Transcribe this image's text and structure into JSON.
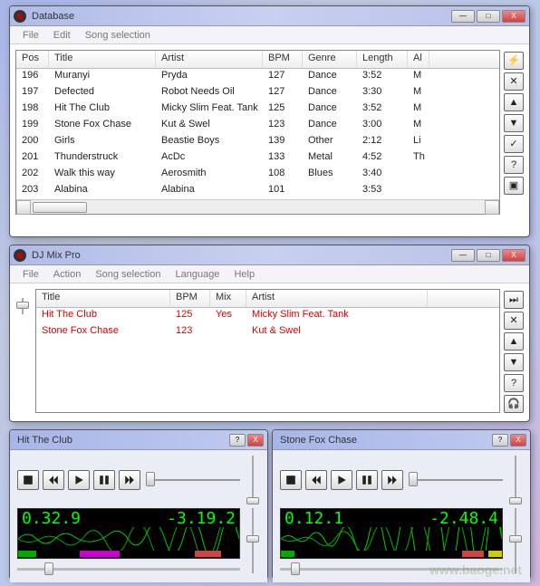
{
  "db": {
    "title": "Database",
    "menu": [
      "File",
      "Edit",
      "Song selection"
    ],
    "headers": {
      "pos": "Pos",
      "title": "Title",
      "artist": "Artist",
      "bpm": "BPM",
      "genre": "Genre",
      "length": "Length",
      "al": "Al"
    },
    "rows": [
      {
        "pos": "196",
        "title": "Muranyi",
        "artist": "Pryda",
        "bpm": "127",
        "genre": "Dance",
        "length": "3:52",
        "al": "M"
      },
      {
        "pos": "197",
        "title": "Defected",
        "artist": "Robot Needs Oil",
        "bpm": "127",
        "genre": "Dance",
        "length": "3:30",
        "al": "M"
      },
      {
        "pos": "198",
        "title": "Hit The Club",
        "artist": "Micky Slim Feat. Tank",
        "bpm": "125",
        "genre": "Dance",
        "length": "3:52",
        "al": "M"
      },
      {
        "pos": "199",
        "title": "Stone Fox Chase",
        "artist": "Kut & Swel",
        "bpm": "123",
        "genre": "Dance",
        "length": "3:00",
        "al": "M"
      },
      {
        "pos": "200",
        "title": "Girls",
        "artist": "Beastie Boys",
        "bpm": "139",
        "genre": "Other",
        "length": "2:12",
        "al": "Li"
      },
      {
        "pos": "201",
        "title": "Thunderstruck",
        "artist": "AcDc",
        "bpm": "133",
        "genre": "Metal",
        "length": "4:52",
        "al": "Th"
      },
      {
        "pos": "202",
        "title": "Walk this way",
        "artist": "Aerosmith",
        "bpm": "108",
        "genre": "Blues",
        "length": "3:40",
        "al": ""
      },
      {
        "pos": "203",
        "title": "Alabina",
        "artist": "Alabina",
        "bpm": "101",
        "genre": "",
        "length": "3:53",
        "al": ""
      }
    ],
    "sidebtns": [
      "⚡",
      "✕",
      "▲",
      "▼",
      "✓",
      "?",
      "▣"
    ]
  },
  "mix": {
    "title": "DJ Mix Pro",
    "menu": [
      "File",
      "Action",
      "Song selection",
      "Language",
      "Help"
    ],
    "headers": {
      "title": "Title",
      "bpm": "BPM",
      "mix": "Mix",
      "artist": "Artist"
    },
    "rows": [
      {
        "title": "Hit The Club",
        "bpm": "125",
        "mix": "Yes",
        "artist": "Micky Slim Feat. Tank"
      },
      {
        "title": "Stone Fox Chase",
        "bpm": "123",
        "mix": "",
        "artist": "Kut & Swel"
      }
    ],
    "sidebtns": [
      "⏭",
      "✕",
      "▲",
      "▼",
      "?",
      "🎧"
    ]
  },
  "players": {
    "a": {
      "title": "Hit The Club",
      "time_l": "0.32.9",
      "time_r": "-3.19.2",
      "bars": [
        {
          "color": "#0a0",
          "l": 0,
          "w": 8
        },
        {
          "color": "#c0c",
          "l": 28,
          "w": 18
        },
        {
          "color": "#c44",
          "l": 80,
          "w": 12
        }
      ],
      "bthumb": 12
    },
    "b": {
      "title": "Stone Fox Chase",
      "time_l": "0.12.1",
      "time_r": "-2.48.4",
      "bars": [
        {
          "color": "#0a0",
          "l": 0,
          "w": 6
        },
        {
          "color": "#c44",
          "l": 82,
          "w": 10
        },
        {
          "color": "#cc0",
          "l": 94,
          "w": 6
        }
      ],
      "bthumb": 5
    }
  },
  "watermark": "www.baoge.net"
}
